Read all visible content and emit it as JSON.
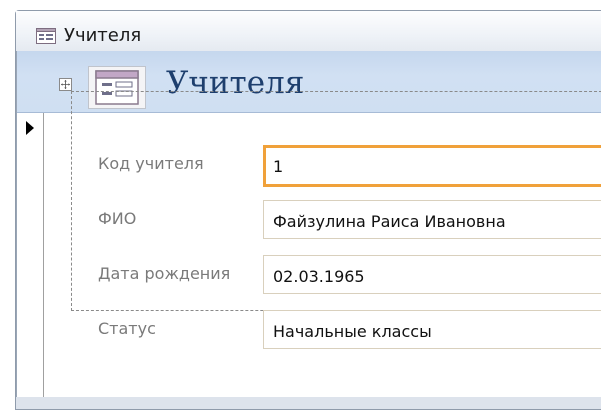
{
  "window": {
    "title": "Учителя",
    "icon": "form-icon"
  },
  "form": {
    "header_title": "Учителя",
    "header_icon": "form-icon",
    "fields": [
      {
        "label": "Код учителя",
        "value": "1",
        "focused": true
      },
      {
        "label": "ФИО",
        "value": "Файзулина Раиса Ивановна",
        "focused": false
      },
      {
        "label": "Дата рождения",
        "value": "02.03.1965",
        "focused": false
      },
      {
        "label": "Статус",
        "value": "Начальные классы",
        "focused": false
      }
    ]
  },
  "colors": {
    "focus_border": "#f0a13a",
    "header_background": "#c9daf0",
    "header_title": "#1e3f6e",
    "label_text": "#7a7a7a"
  }
}
